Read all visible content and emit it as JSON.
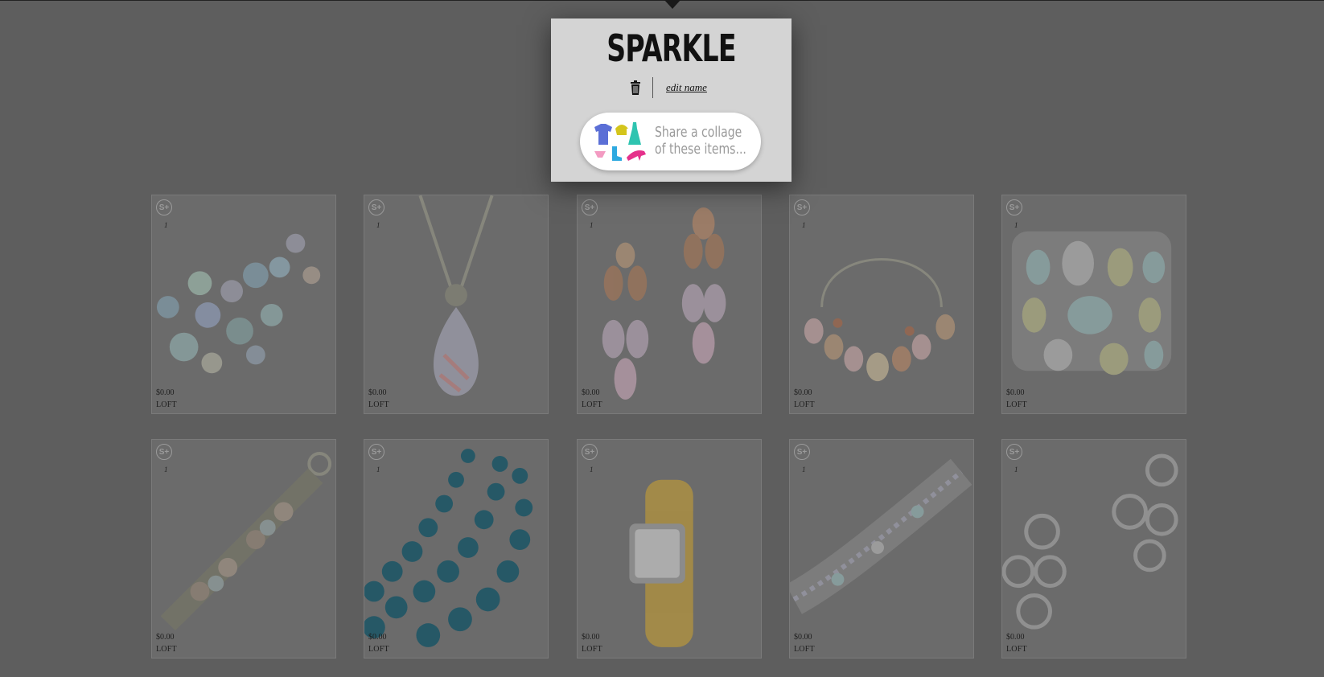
{
  "board": {
    "title": "SPARKLE",
    "edit_name_label": "edit name",
    "share_label_line1": "Share a collage",
    "share_label_line2": "of these items..."
  },
  "products": [
    {
      "price": "$0.00",
      "brand": "LOFT",
      "count": "1",
      "badge": "S+",
      "item": "bracelet-beaded"
    },
    {
      "price": "$0.00",
      "brand": "LOFT",
      "count": "1",
      "badge": "S+",
      "item": "pendant-necklace"
    },
    {
      "price": "$0.00",
      "brand": "LOFT",
      "count": "1",
      "badge": "S+",
      "item": "drop-earrings"
    },
    {
      "price": "$0.00",
      "brand": "LOFT",
      "count": "1",
      "badge": "S+",
      "item": "statement-necklace"
    },
    {
      "price": "$0.00",
      "brand": "LOFT",
      "count": "1",
      "badge": "S+",
      "item": "jeweled-cuff"
    },
    {
      "price": "$0.00",
      "brand": "LOFT",
      "count": "1",
      "badge": "S+",
      "item": "flower-bracelet"
    },
    {
      "price": "$0.00",
      "brand": "LOFT",
      "count": "1",
      "badge": "S+",
      "item": "turquoise-beads"
    },
    {
      "price": "$0.00",
      "brand": "LOFT",
      "count": "1",
      "badge": "S+",
      "item": "wrap-watch"
    },
    {
      "price": "$0.00",
      "brand": "LOFT",
      "count": "1",
      "badge": "S+",
      "item": "crystal-bracelet"
    },
    {
      "price": "$0.00",
      "brand": "LOFT",
      "count": "1",
      "badge": "S+",
      "item": "cluster-earrings"
    }
  ],
  "icons": {
    "trash": "trash-icon",
    "collage": "collage-clothing-icon",
    "plus_badge": "s-plus-badge-icon"
  },
  "colors": {
    "overlay": "#5e5e5e",
    "popup_bg": "#d4d4d4",
    "share_text": "#9a9a9a"
  }
}
